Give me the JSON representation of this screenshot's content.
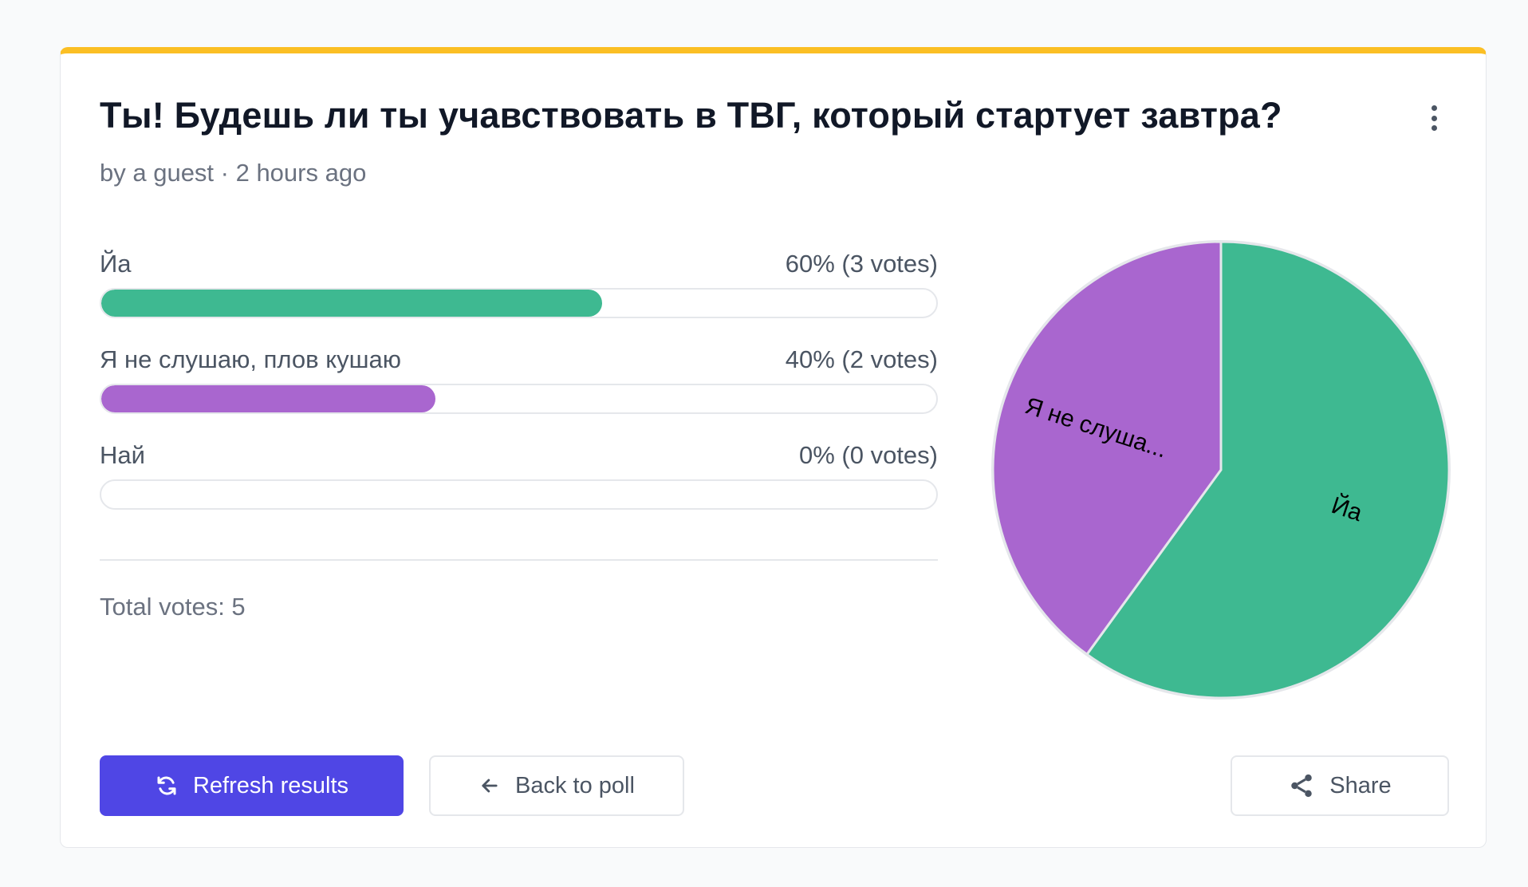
{
  "poll": {
    "title": "Ты! Будешь ли ты учавствовать в ТВГ, который стартует завтра?",
    "meta": "by a guest · 2 hours ago",
    "options": [
      {
        "label": "Йа",
        "result": "60% (3 votes)",
        "fraction": 0.6,
        "color": "#3eb991"
      },
      {
        "label": "Я не слушаю, плов кушаю",
        "result": "40% (2 votes)",
        "fraction": 0.4,
        "color": "#a966cf"
      },
      {
        "label": "Най",
        "result": "0% (0 votes)",
        "fraction": 0,
        "color": "#3eb991"
      }
    ],
    "total": "Total votes: 5"
  },
  "chart_data": {
    "type": "pie",
    "categories": [
      "Йа",
      "Я не слуша...",
      "Най"
    ],
    "values": [
      3,
      2,
      0
    ],
    "colors": [
      "#3eb991",
      "#a966cf",
      "#d1d5db"
    ]
  },
  "actions": {
    "refresh_label": "Refresh results",
    "back_label": "Back to poll",
    "share_label": "Share"
  },
  "icons": {
    "menu": "more-vertical-icon",
    "refresh": "refresh-icon",
    "back": "arrow-left-icon",
    "share": "share-icon"
  },
  "colors": {
    "accent": "#4f46e5",
    "top_border": "#fbbf24"
  }
}
